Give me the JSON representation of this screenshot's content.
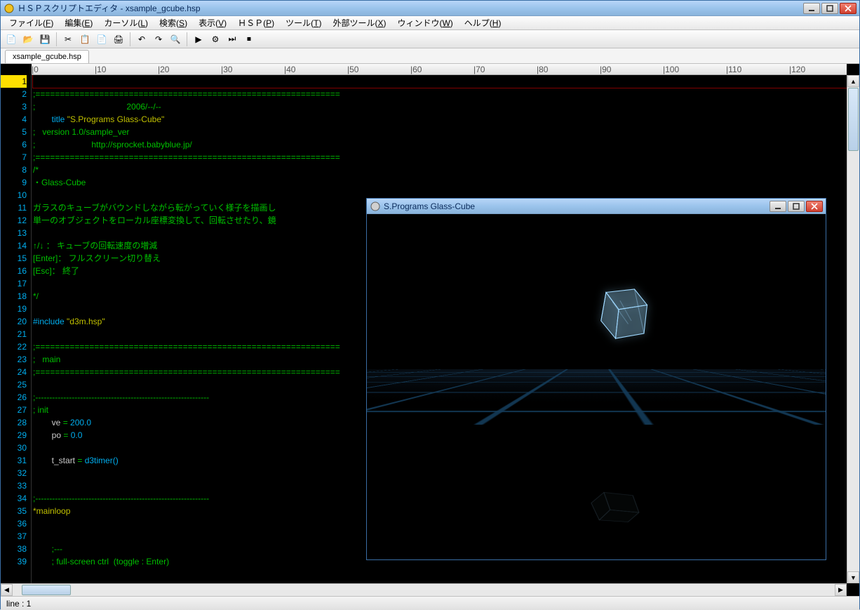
{
  "main_window": {
    "title": "ＨＳＰスクリプトエディタ - xsample_gcube.hsp",
    "menus": [
      "ファイル(F)",
      "編集(E)",
      "カーソル(L)",
      "検索(S)",
      "表示(V)",
      "ＨＳＰ(P)",
      "ツール(T)",
      "外部ツール(X)",
      "ウィンドウ(W)",
      "ヘルプ(H)"
    ],
    "toolbar_icons": [
      "new",
      "open",
      "save",
      "cut",
      "copy",
      "paste",
      "print",
      "undo",
      "redo",
      "find",
      "exec",
      "run",
      "step",
      "stop"
    ],
    "tab_label": "xsample_gcube.hsp",
    "ruler_marks": [
      0,
      10,
      20,
      30,
      40,
      50,
      60,
      70,
      80,
      90,
      100,
      110,
      120
    ],
    "status": "line : 1"
  },
  "code": {
    "first_line_no": 1,
    "lines": [
      {
        "n": 1,
        "t": "",
        "cur": true
      },
      {
        "n": 2,
        "t": ";==============================================================",
        "cls": "cmt"
      },
      {
        "n": 3,
        "t": ";                                       2006/--/--",
        "cls": "cmt"
      },
      {
        "n": 4,
        "seg": [
          {
            "t": "\ttitle ",
            "cls": "kw"
          },
          {
            "t": "\"S.Programs Glass-Cube\"",
            "cls": "str"
          }
        ]
      },
      {
        "n": 5,
        "t": ";   version 1.0/sample_ver",
        "cls": "cmt"
      },
      {
        "n": 6,
        "t": ";                        http://sprocket.babyblue.jp/",
        "cls": "cmt"
      },
      {
        "n": 7,
        "t": ";==============================================================",
        "cls": "cmt"
      },
      {
        "n": 8,
        "t": "/*",
        "cls": "cmt"
      },
      {
        "n": 9,
        "t": "・Glass-Cube",
        "cls": "cmt"
      },
      {
        "n": 10,
        "t": "",
        "cls": "cmt"
      },
      {
        "n": 11,
        "t": "ガラスのキューブがバウンドしながら転がっていく様子を描画し",
        "cls": "cmt"
      },
      {
        "n": 12,
        "t": "単一のオブジェクトをローカル座標変換して、回転させたり、鏡",
        "cls": "cmt"
      },
      {
        "n": 13,
        "t": "",
        "cls": "cmt"
      },
      {
        "n": 14,
        "t": "↑/↓ ： キューブの回転速度の増減",
        "cls": "cmt"
      },
      {
        "n": 15,
        "t": "[Enter]： フルスクリーン切り替え",
        "cls": "cmt"
      },
      {
        "n": 16,
        "t": "[Esc]： 終了",
        "cls": "cmt"
      },
      {
        "n": 17,
        "t": "",
        "cls": "cmt"
      },
      {
        "n": 18,
        "t": "*/",
        "cls": "cmt"
      },
      {
        "n": 19,
        "t": ""
      },
      {
        "n": 20,
        "seg": [
          {
            "t": "#include ",
            "cls": "kw"
          },
          {
            "t": "\"d3m.hsp\"",
            "cls": "str"
          }
        ]
      },
      {
        "n": 21,
        "t": ""
      },
      {
        "n": 22,
        "t": ";==============================================================",
        "cls": "cmt"
      },
      {
        "n": 23,
        "t": ";   main",
        "cls": "cmt"
      },
      {
        "n": 24,
        "t": ";==============================================================",
        "cls": "cmt"
      },
      {
        "n": 25,
        "t": ""
      },
      {
        "n": 26,
        "t": ";--------------------------------------------------------------",
        "cls": "cmt"
      },
      {
        "n": 27,
        "t": "; init",
        "cls": "cmt"
      },
      {
        "n": 28,
        "seg": [
          {
            "t": "\tve ",
            "cls": ""
          },
          {
            "t": "= ",
            "cls": "op"
          },
          {
            "t": "200.0",
            "cls": "kw"
          }
        ]
      },
      {
        "n": 29,
        "seg": [
          {
            "t": "\tpo ",
            "cls": ""
          },
          {
            "t": "= ",
            "cls": "op"
          },
          {
            "t": "0.0",
            "cls": "kw"
          }
        ]
      },
      {
        "n": 30,
        "t": ""
      },
      {
        "n": 31,
        "seg": [
          {
            "t": "\tt_start ",
            "cls": ""
          },
          {
            "t": "= ",
            "cls": "op"
          },
          {
            "t": "d3timer()",
            "cls": "kw"
          }
        ]
      },
      {
        "n": 32,
        "t": ""
      },
      {
        "n": 33,
        "t": ""
      },
      {
        "n": 34,
        "t": ";--------------------------------------------------------------",
        "cls": "cmt"
      },
      {
        "n": 35,
        "seg": [
          {
            "t": "*mainloop",
            "cls": "str"
          }
        ]
      },
      {
        "n": 36,
        "t": ""
      },
      {
        "n": 37,
        "t": ""
      },
      {
        "n": 38,
        "t": "\t;---",
        "cls": "cmt"
      },
      {
        "n": 39,
        "t": "\t; full-screen ctrl  (toggle : Enter)",
        "cls": "cmt"
      }
    ]
  },
  "child_window": {
    "title": "S.Programs Glass-Cube"
  }
}
